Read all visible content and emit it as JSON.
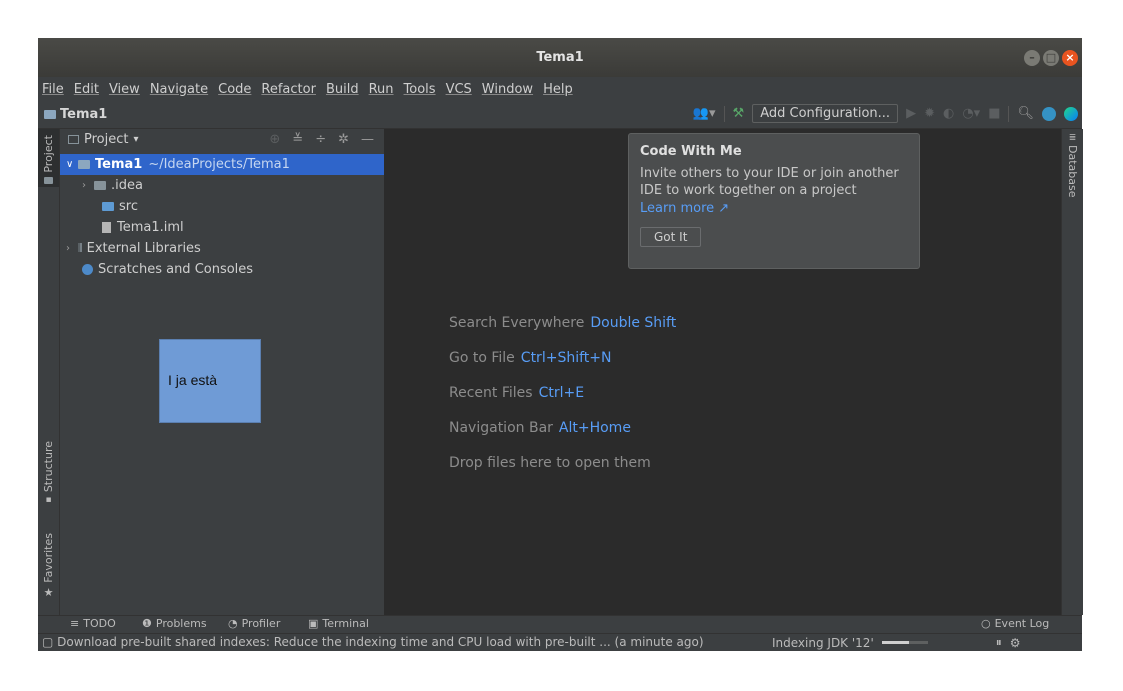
{
  "window": {
    "title": "Tema1"
  },
  "menu": [
    "File",
    "Edit",
    "View",
    "Navigate",
    "Code",
    "Refactor",
    "Build",
    "Run",
    "Tools",
    "VCS",
    "Window",
    "Help"
  ],
  "navbar": {
    "project": "Tema1",
    "add_config": "Add Configuration..."
  },
  "left_tabs": {
    "project": "Project",
    "structure": "Structure",
    "favorites": "Favorites"
  },
  "project_panel": {
    "title": "Project",
    "tree": {
      "root": "Tema1",
      "root_path": "~/IdeaProjects/Tema1",
      "idea": ".idea",
      "src": "src",
      "iml": "Tema1.iml",
      "ext_libs": "External Libraries",
      "scratches": "Scratches and Consoles"
    }
  },
  "sticky_note": "I ja està",
  "editor_hints": [
    {
      "label": "Search Everywhere",
      "key": "Double Shift"
    },
    {
      "label": "Go to File",
      "key": "Ctrl+Shift+N"
    },
    {
      "label": "Recent Files",
      "key": "Ctrl+E"
    },
    {
      "label": "Navigation Bar",
      "key": "Alt+Home"
    },
    {
      "label": "Drop files here to open them",
      "key": ""
    }
  ],
  "popup": {
    "title": "Code With Me",
    "text": "Invite others to your IDE or join another IDE to work together on a project",
    "link": "Learn more ↗",
    "button": "Got It"
  },
  "right_tabs": {
    "database": "Database"
  },
  "bottom_tools": {
    "todo": "TODO",
    "problems": "Problems",
    "profiler": "Profiler",
    "terminal": "Terminal",
    "event_log": "Event Log"
  },
  "status": {
    "message": "Download pre-built shared indexes: Reduce the indexing time and CPU load with pre-built ... (a minute ago)",
    "indexing": "Indexing JDK '12'",
    "progress": 0.6
  },
  "colors": {
    "selection": "#2f65ca",
    "link": "#589df6",
    "sticky": "#6f9bd6",
    "close": "#e95420"
  }
}
